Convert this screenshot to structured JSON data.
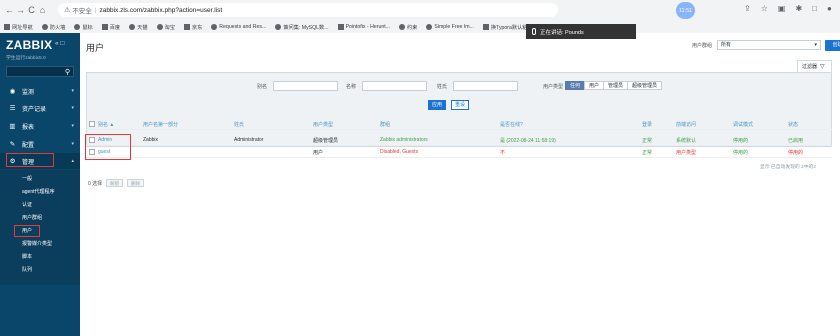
{
  "browser": {
    "url_not_secure": "不安全",
    "url": "zabbix.zls.com/zabbix.php?action=user.list",
    "time_badge": "11:51",
    "bookmarks": [
      "网址导航",
      "防火墙",
      "鼠标",
      "百度",
      "天猫",
      "淘宝",
      "京东",
      "Requests and Res...",
      "策问集: MySQL数...",
      "Pointofix - Herunt...",
      "约束",
      "Simple Free Im...",
      "换Typora默认粘...",
      "教你图片",
      "Sakurairo - 精致唯..."
    ],
    "toast_text": "正在讲话: Pounds"
  },
  "sidebar": {
    "logo": "ZABBIX",
    "collapse": "«  □",
    "subtitle": "学生运行zabbix5.0",
    "menu": [
      {
        "label": "监测",
        "icon": "eye-icon"
      },
      {
        "label": "资产记录",
        "icon": "list-icon"
      },
      {
        "label": "报表",
        "icon": "chart-icon"
      },
      {
        "label": "配置",
        "icon": "wrench-icon"
      },
      {
        "label": "管理",
        "icon": "gear-icon"
      }
    ],
    "admin_sub": [
      "一般",
      "agent代理程序",
      "认证",
      "用户群组",
      "用户",
      "报警媒介类型",
      "脚本",
      "队列"
    ]
  },
  "header": {
    "title": "用户",
    "group_filter_label": "用户群组",
    "group_filter_value": "所有",
    "create_button": "创建用户",
    "filter_tab": "过滤器"
  },
  "filter": {
    "alias_label": "别名",
    "name_label": "名称",
    "surname_label": "姓氏",
    "usertype_label": "用户类型",
    "usertypes": [
      "任何",
      "用户",
      "管理员",
      "超级管理员"
    ],
    "apply": "应用",
    "reset": "重设"
  },
  "table": {
    "headers": [
      "别名 ▲",
      "用户名第一部分",
      "姓氏",
      "用户类型",
      "群组",
      "是否在线?",
      "登录",
      "前端访问",
      "调试模式",
      "状态"
    ],
    "rows": [
      {
        "alias": "Admin",
        "name": "Zabbix",
        "surname": "Administrator",
        "type": "超级管理员",
        "groups": "Zabbix administrators",
        "online": "是 (2022-08-24 11:58:19)",
        "login": "正常",
        "frontend": "系统默认",
        "debug": "停用的",
        "status": "已启用"
      },
      {
        "alias": "guest",
        "name": "",
        "surname": "",
        "type": "用户",
        "groups": "Disabled, Guests",
        "online": "不",
        "login": "正常",
        "frontend": "用户类型",
        "debug": "停用的",
        "status": "停用的"
      }
    ],
    "displaying": "显示 已自动发现的 2中的2",
    "selected": "0 选择",
    "unblock": "解锁",
    "delete": "删除"
  },
  "colors": {
    "sidebar_bg": "#0a466a",
    "accent_blue": "#1a73d0",
    "link_blue": "#4796c4",
    "red": "#e53935",
    "green": "#429e47"
  }
}
